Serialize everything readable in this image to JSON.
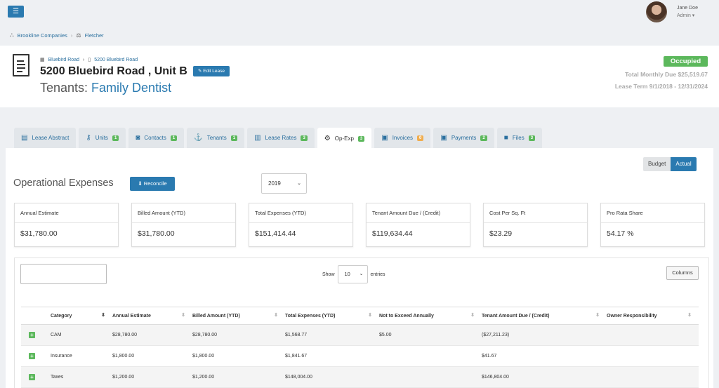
{
  "topbar": {
    "menu_icon": "☰",
    "user_name": "Jane Doe",
    "user_role": "Admin ▾"
  },
  "breadcrumb": {
    "company": "Brookline Companies",
    "property": "Fletcher"
  },
  "header": {
    "sub_crumb_property": "Bluebird Road",
    "sub_crumb_unit": "5200 Bluebird Road",
    "title": "5200 Bluebird Road , Unit B",
    "edit_label": "✎ Edit Lease",
    "tenants_prefix": "Tenants: ",
    "tenant_name": "Family Dentist",
    "status": "Occupied",
    "status_color": "#5cb85c",
    "total_due": "Total Monthly Due $25,519.67",
    "lease_term": "Lease Term 9/1/2018 - 12/31/2024"
  },
  "tabs": [
    {
      "label": "Lease Abstract",
      "icon": "document-icon",
      "count": ""
    },
    {
      "label": "Units",
      "icon": "key-icon",
      "count": "1"
    },
    {
      "label": "Contacts",
      "icon": "contact-card-icon",
      "count": "1"
    },
    {
      "label": "Tenants",
      "icon": "anchor-icon",
      "count": "1"
    },
    {
      "label": "Lease Rates",
      "icon": "rate-icon",
      "count": "3"
    },
    {
      "label": "Op-Exp",
      "icon": "cogs-icon",
      "count": "3"
    },
    {
      "label": "Invoices",
      "icon": "money-icon",
      "count": "0"
    },
    {
      "label": "Payments",
      "icon": "money-icon",
      "count": "2"
    },
    {
      "label": "Files",
      "icon": "folder-icon",
      "count": "3"
    }
  ],
  "main": {
    "budget_label": "Budget",
    "actual_label": "Actual",
    "section_title": "Operational Expenses",
    "reconcile_label": "⬇ Reconcile",
    "year": "2019",
    "stats": [
      {
        "label": "Annual Estimate",
        "value": "$31,780.00"
      },
      {
        "label": "Billed Amount (YTD)",
        "value": "$31,780.00"
      },
      {
        "label": "Total Expenses (YTD)",
        "value": "$151,414.44"
      },
      {
        "label": "Tenant Amount Due / (Credit)",
        "value": "$119,634.44"
      },
      {
        "label": "Cost Per Sq. Ft",
        "value": "$23.29"
      },
      {
        "label": "Pro Rata Share",
        "value": "54.17 %"
      }
    ],
    "table": {
      "show_label": "Show",
      "entries_value": "10",
      "entries_label": "entries",
      "columns_label": "Columns",
      "headers": [
        "Category",
        "Annual Estimate",
        "Billed Amount (YTD)",
        "Total Expenses (YTD)",
        "Not to Exceed Annually",
        "Tenant Amount Due / (Credit)",
        "Owner Responsibility"
      ],
      "rows": [
        [
          "CAM",
          "$28,780.00",
          "$28,780.00",
          "$1,568.77",
          "$5.00",
          "($27,211.23)",
          ""
        ],
        [
          "Insurance",
          "$1,800.00",
          "$1,800.00",
          "$1,841.67",
          "",
          "$41.67",
          ""
        ],
        [
          "Taxes",
          "$1,200.00",
          "$1,200.00",
          "$148,004.00",
          "",
          "$146,804.00",
          ""
        ]
      ]
    }
  }
}
